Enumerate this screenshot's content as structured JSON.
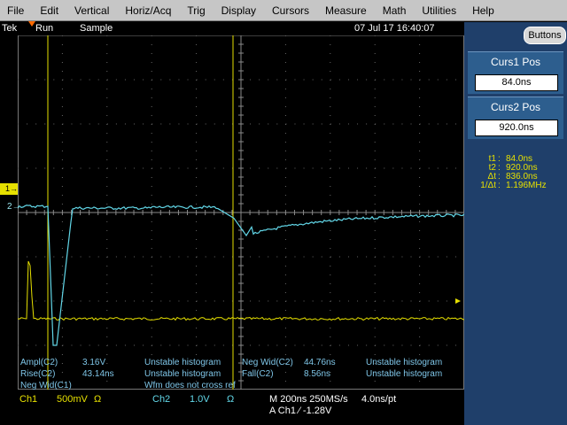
{
  "menu": [
    "File",
    "Edit",
    "Vertical",
    "Horiz/Acq",
    "Trig",
    "Display",
    "Cursors",
    "Measure",
    "Math",
    "Utilities",
    "Help"
  ],
  "status": {
    "brand": "Tek",
    "run": "Run",
    "acq_mode": "Sample",
    "datetime": "07 Jul 17  16:40:07"
  },
  "colors": {
    "ch1": "#e6e000",
    "ch2": "#62d7e8",
    "panel": "#1f3f6a"
  },
  "side_panel": {
    "buttons_label": "Buttons",
    "curs1": {
      "title": "Curs1 Pos",
      "value": "84.0ns"
    },
    "curs2": {
      "title": "Curs2 Pos",
      "value": "920.0ns"
    },
    "readout": [
      {
        "key": "t1",
        "value": "84.0ns"
      },
      {
        "key": "t2",
        "value": "920.0ns"
      },
      {
        "key": "Δt",
        "value": "836.0ns"
      },
      {
        "key": "1/Δt",
        "value": "1.196MHz"
      }
    ]
  },
  "measurements": [
    {
      "label": "Ampl(C2)",
      "value": "3.16V",
      "note": "Unstable histogram"
    },
    {
      "label": "Rise(C2)",
      "value": "43.14ns",
      "note": "Unstable histogram"
    },
    {
      "label": "Neg Wid(C1)",
      "value": "",
      "note": "Wfm does not cross ref"
    },
    {
      "label": "Neg Wid(C2)",
      "value": "44.76ns",
      "note": "Unstable histogram"
    },
    {
      "label": "Fall(C2)",
      "value": "8.56ns",
      "note": "Unstable histogram"
    }
  ],
  "channels": {
    "ch1": {
      "name": "Ch1",
      "scale": "500mV",
      "coupling": "Ω"
    },
    "ch2": {
      "name": "Ch2",
      "scale": "1.0V",
      "coupling": "Ω"
    }
  },
  "timebase": {
    "line1": "M 200ns 250MS/s",
    "res": "4.0ns/pt",
    "trigger": "A  Ch1  ⁄  -1.28V"
  },
  "markers": {
    "trigger": "1",
    "ch2": "2"
  }
}
